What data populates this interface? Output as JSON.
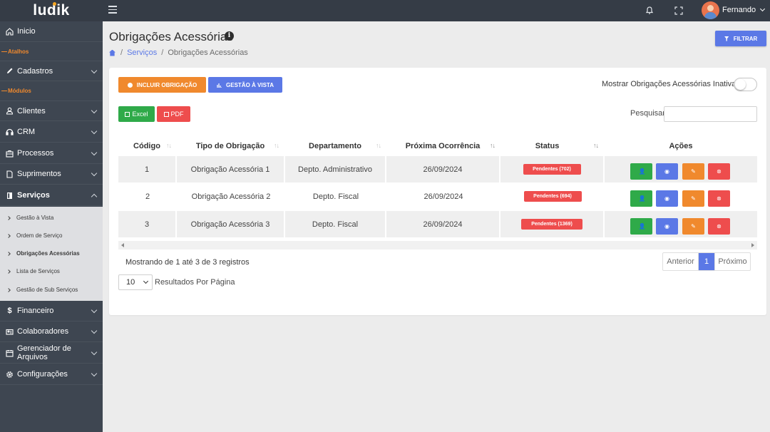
{
  "app": {
    "logo": "ludik",
    "user_name": "Fernando"
  },
  "colors": {
    "topbar": "#353c46",
    "sidebar": "#3e4651",
    "accent_blue": "#5b78e6",
    "accent_orange": "#f0892d",
    "green": "#2faa49",
    "red": "#ee4d4d"
  },
  "icons": {
    "menu": "hamburger-icon",
    "notifications": "bell-icon",
    "fullscreen": "expand-icon"
  },
  "sidebar": {
    "inicio": "Inicio",
    "section_atalhos": "Atalhos",
    "cadastros": "Cadastros",
    "section_modulos": "Módulos",
    "clientes": "Clientes",
    "crm": "CRM",
    "processos": "Processos",
    "suprimentos": "Suprimentos",
    "servicos": "Serviços",
    "sub": [
      "Gestão à Vista",
      "Ordem de Serviço",
      "Obrigações Acessórias",
      "Lista de Serviços",
      "Gestão de Sub Serviços"
    ],
    "financeiro": "Financeiro",
    "colaboradores": "Colaboradores",
    "arquivos": "Gerenciador de Arquivos",
    "configuracoes": "Configurações"
  },
  "page": {
    "title": "Obrigações Acessórias",
    "breadcrumb": [
      "Serviços",
      "Obrigações Acessórias"
    ],
    "filter_button": "FILTRAR"
  },
  "actions": {
    "incluir": "INCLUIR OBRIGAÇÃO",
    "gestao": "GESTÃO À VISTA",
    "toggle_label": "Mostrar Obrigações Acessórias Inativas",
    "excel": "Excel",
    "pdf": "PDF",
    "search_label": "Pesquisar",
    "search_value": ""
  },
  "table": {
    "headers": [
      "Código",
      "Tipo de Obrigação",
      "Departamento",
      "Próxima Ocorrência",
      "Status",
      "Ações"
    ],
    "rows": [
      {
        "codigo": "1",
        "tipo": "Obrigação Acessória 1",
        "departamento": "Depto. Administrativo",
        "proxima": "26/09/2024",
        "status": "Pendentes (702)"
      },
      {
        "codigo": "2",
        "tipo": "Obrigação Acessória 2",
        "departamento": "Depto. Fiscal",
        "proxima": "26/09/2024",
        "status": "Pendentes (694)"
      },
      {
        "codigo": "3",
        "tipo": "Obrigação Acessória 3",
        "departamento": "Depto. Fiscal",
        "proxima": "26/09/2024",
        "status": "Pendentes (1369)"
      }
    ]
  },
  "footer": {
    "info": "Mostrando de 1 até 3 de 3 registros",
    "prev": "Anterior",
    "current_page": "1",
    "next": "Próximo",
    "per_page": "10",
    "per_page_label": "Resultados Por Página"
  }
}
